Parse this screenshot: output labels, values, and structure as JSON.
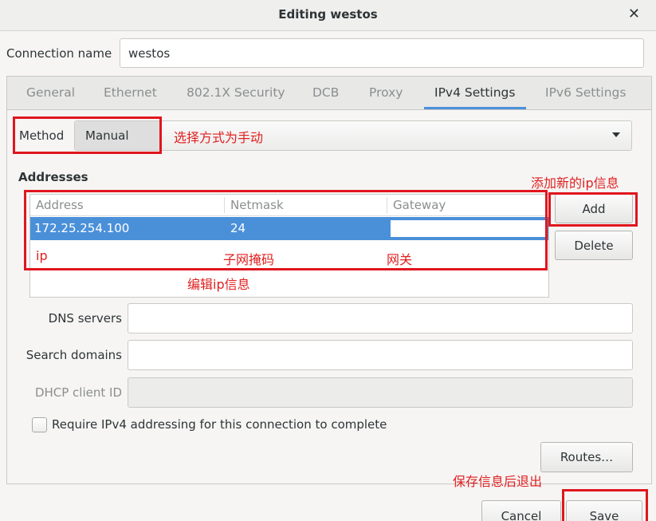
{
  "window": {
    "title": "Editing westos"
  },
  "connection": {
    "label": "Connection name",
    "value": "westos"
  },
  "tabs": [
    {
      "label": "General"
    },
    {
      "label": "Ethernet"
    },
    {
      "label": "802.1X Security"
    },
    {
      "label": "DCB"
    },
    {
      "label": "Proxy"
    },
    {
      "label": "IPv4 Settings",
      "active": true
    },
    {
      "label": "IPv6 Settings"
    }
  ],
  "method": {
    "label": "Method",
    "value": "Manual"
  },
  "addresses": {
    "label": "Addresses",
    "columns": [
      "Address",
      "Netmask",
      "Gateway"
    ],
    "rows": [
      {
        "address": "172.25.254.100",
        "netmask": "24",
        "gateway": ""
      }
    ],
    "add_label": "Add",
    "delete_label": "Delete"
  },
  "fields": {
    "dns_label": "DNS servers",
    "search_label": "Search domains",
    "dhcp_label": "DHCP client ID"
  },
  "require_ipv4_label": "Require IPv4 addressing for this connection to complete",
  "buttons": {
    "routes": "Routes…",
    "cancel": "Cancel",
    "save": "Save"
  },
  "annotations": {
    "method_note": "选择方式为手动",
    "add_note": "添加新的ip信息",
    "ip_note": "ip",
    "netmask_note": "子网掩码",
    "gateway_note": "网关",
    "edit_note": "编辑ip信息",
    "save_note": "保存信息后退出"
  },
  "colors": {
    "accent": "#4a90d9",
    "annotation": "#e0161e"
  }
}
